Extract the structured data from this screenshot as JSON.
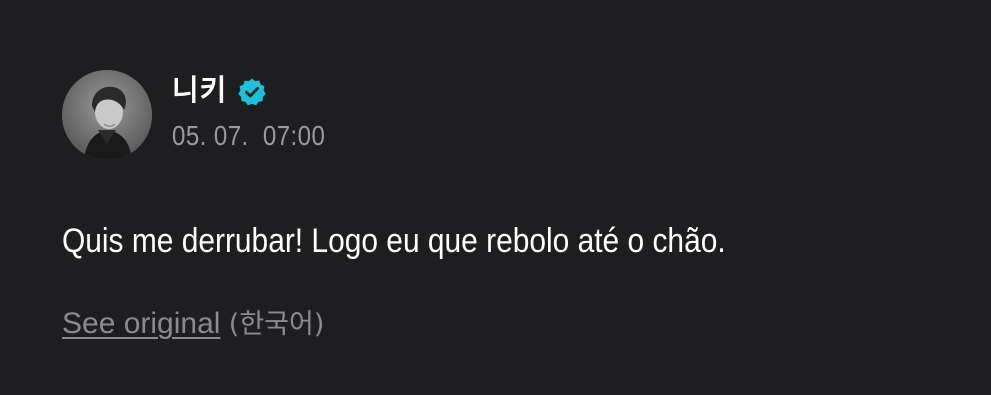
{
  "post": {
    "author_name": "니키",
    "verified_icon": "verified-badge-icon",
    "avatar_icon": "profile-photo",
    "timestamp": "05. 07.  07:00",
    "message": "Quis me derrubar! Logo eu que rebolo até o chão.",
    "see_original_label": "See original",
    "source_language": "(한국어)"
  },
  "colors": {
    "background": "#1e1e20",
    "text_primary": "#ffffff",
    "text_secondary": "#9a9a9c",
    "link_muted": "#8b8b8d",
    "verified_badge": "#19c3d9"
  }
}
